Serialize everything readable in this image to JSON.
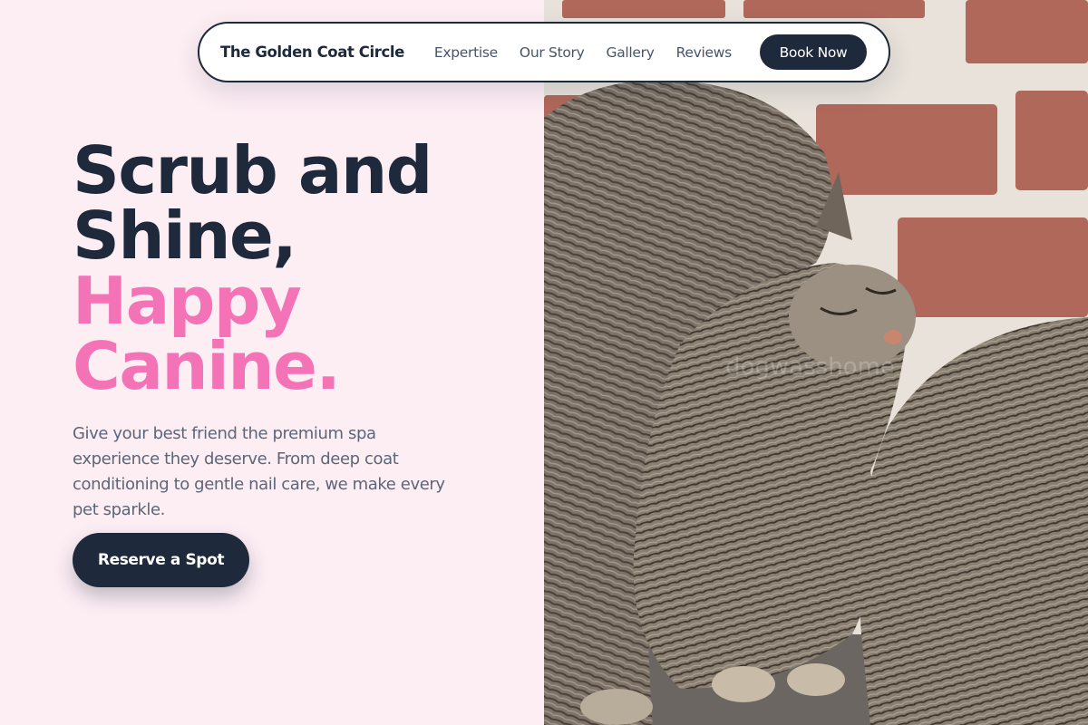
{
  "nav": {
    "brand": "The Golden Coat Circle",
    "links": [
      "Expertise",
      "Our Story",
      "Gallery",
      "Reviews"
    ],
    "cta": "Book Now"
  },
  "hero": {
    "headline_dark_1": "Scrub and",
    "headline_dark_2": "Shine,",
    "headline_pink_1": "Happy",
    "headline_pink_2": "Canine.",
    "subtext": "Give your best friend the premium spa experience they deserve. From deep coat conditioning to gentle nail care, we make every pet sparkle.",
    "cta": "Reserve a Spot",
    "image_watermark": "dogwasshome"
  },
  "colors": {
    "background": "#fdeef4",
    "navy": "#1e293b",
    "accent_pink": "#f472b6",
    "muted_text": "#5b6678"
  },
  "image": {
    "subject": "two tabby cats nuzzling in front of a red brick wall"
  }
}
